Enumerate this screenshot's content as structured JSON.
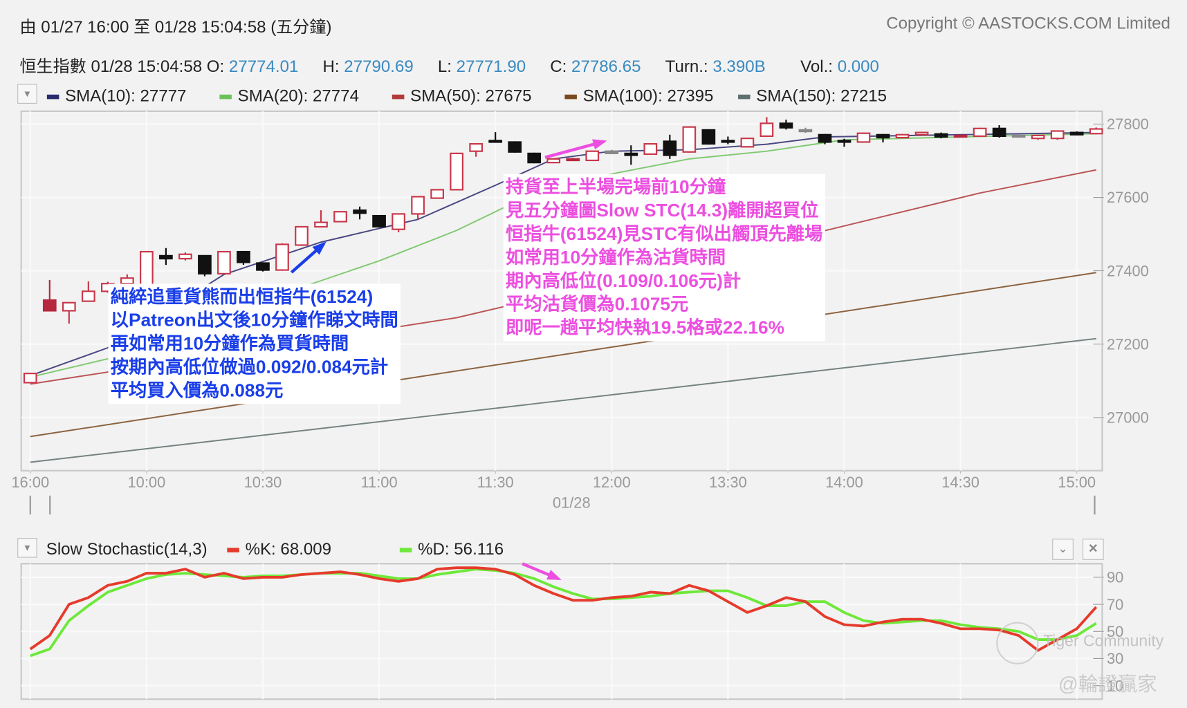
{
  "header": {
    "range_text": "由  01/27 16:00 至  01/28 15:04:58 (五分鐘)",
    "copyright": "Copyright © AASTOCKS.COM Limited"
  },
  "quote": {
    "name_time": "恒生指數 01/28 15:04:58 O:",
    "open": "27774.01",
    "high_label": "H:",
    "high": "27790.69",
    "low_label": "L:",
    "low": "27771.90",
    "close_label": "C:",
    "close": "27786.65",
    "turn_label": "Turn.:",
    "turn": "3.390B",
    "vol_label": "Vol.:",
    "vol": "0.000"
  },
  "legend": [
    {
      "label": "SMA(10): 27777",
      "color": "#2b2a6e"
    },
    {
      "label": "SMA(20): 27774",
      "color": "#6cc25a"
    },
    {
      "label": "SMA(50): 27675",
      "color": "#b23a3a"
    },
    {
      "label": "SMA(100): 27395",
      "color": "#7a4a1e"
    },
    {
      "label": "SMA(150): 27215",
      "color": "#5e6e6e"
    }
  ],
  "stoch_legend": {
    "title": "Slow Stochastic(14,3)",
    "k_label": "%K: 68.009",
    "k_color": "#e53b2c",
    "d_label": "%D: 56.116",
    "d_color": "#6ee83a"
  },
  "annotations": {
    "buy": [
      "純綷追重貨熊而出恒指牛(61524)",
      "以Patreon出文後10分鐘作睇文時間",
      "再如常用10分鐘作為買貨時間",
      "按期內高低位做過0.092/0.084元計",
      "平均買入價為0.088元"
    ],
    "sell": [
      "持貨至上半場完場前10分鐘",
      "見五分鐘圖Slow STC(14.3)離開超買位",
      "恒指牛(61524)見STC有似出觸頂先離場",
      "如常用10分鐘作為沽貨時間",
      "期內高低位(0.109/0.106元)計",
      "平均沽貨價為0.1075元",
      "即呢一趟平均快執19.5格或22.16%"
    ],
    "buy_color": "#1a3ee8",
    "sell_color": "#ec4fe0"
  },
  "watermark": {
    "logo_text": "Tiger Community",
    "author": "@輪證贏家"
  },
  "chart_data": [
    {
      "type": "candlestick",
      "title": "恒生指數 5-minute",
      "ylim": [
        26855,
        27835
      ],
      "y_ticks": [
        "27800",
        "27600",
        "27400",
        "27200",
        "27000"
      ],
      "y_tick_values": [
        27800,
        27600,
        27400,
        27200,
        27000
      ],
      "x_ticks": [
        {
          "label": "16:00",
          "index": 0
        },
        {
          "label": "10:00",
          "index": 6
        },
        {
          "label": "10:30",
          "index": 12
        },
        {
          "label": "11:00",
          "index": 18
        },
        {
          "label": "11:30",
          "index": 24
        },
        {
          "label": "12:00",
          "index": 30
        },
        {
          "label": "13:30",
          "index": 36
        },
        {
          "label": "14:00",
          "index": 42
        },
        {
          "label": "14:30",
          "index": 48
        },
        {
          "label": "15:00",
          "index": 54
        }
      ],
      "date_label": "01/28",
      "candles": [
        [
          27095,
          27122,
          27093,
          27120,
          "hollow"
        ],
        [
          27320,
          27375,
          27291,
          27291,
          "red"
        ],
        [
          27291,
          27313,
          27256,
          27313,
          "hollow"
        ],
        [
          27317,
          27371,
          27317,
          27344,
          "hollow"
        ],
        [
          27344,
          27370,
          27340,
          27365,
          "hollow"
        ],
        [
          27365,
          27390,
          27360,
          27380,
          "hollow"
        ],
        [
          27344,
          27452,
          27340,
          27452,
          "hollow"
        ],
        [
          27441,
          27462,
          27416,
          27433,
          "black"
        ],
        [
          27433,
          27450,
          27428,
          27445,
          "hollow"
        ],
        [
          27441,
          27441,
          27385,
          27392,
          "black"
        ],
        [
          27392,
          27452,
          27392,
          27452,
          "hollow"
        ],
        [
          27452,
          27452,
          27416,
          27423,
          "black"
        ],
        [
          27421,
          27421,
          27398,
          27402,
          "black"
        ],
        [
          27402,
          27475,
          27400,
          27472,
          "hollow"
        ],
        [
          27470,
          27520,
          27468,
          27520,
          "hollow"
        ],
        [
          27520,
          27565,
          27520,
          27532,
          "hollow"
        ],
        [
          27534,
          27561,
          27534,
          27561,
          "hollow"
        ],
        [
          27565,
          27575,
          27540,
          27557,
          "black"
        ],
        [
          27550,
          27550,
          27518,
          27520,
          "black"
        ],
        [
          27513,
          27555,
          27505,
          27555,
          "hollow"
        ],
        [
          27555,
          27602,
          27540,
          27602,
          "hollow"
        ],
        [
          27598,
          27621,
          27598,
          27621,
          "hollow"
        ],
        [
          27621,
          27722,
          27621,
          27720,
          "hollow"
        ],
        [
          27726,
          27748,
          27711,
          27746,
          "hollow"
        ],
        [
          27755,
          27778,
          27751,
          27751,
          "black"
        ],
        [
          27751,
          27753,
          27722,
          27724,
          "black"
        ],
        [
          27720,
          27722,
          27693,
          27695,
          "black"
        ],
        [
          27695,
          27707,
          27693,
          27705,
          "hollow"
        ],
        [
          27705,
          27708,
          27699,
          27701,
          "red"
        ],
        [
          27701,
          27728,
          27699,
          27726,
          "hollow"
        ],
        [
          27726,
          27730,
          27718,
          27720,
          "gray"
        ],
        [
          27720,
          27742,
          27689,
          27715,
          "black"
        ],
        [
          27718,
          27748,
          27716,
          27746,
          "hollow"
        ],
        [
          27753,
          27771,
          27705,
          27715,
          "black"
        ],
        [
          27724,
          27794,
          27722,
          27792,
          "hollow"
        ],
        [
          27784,
          27786,
          27744,
          27746,
          "black"
        ],
        [
          27755,
          27766,
          27745,
          27751,
          "black"
        ],
        [
          27738,
          27763,
          27736,
          27761,
          "hollow"
        ],
        [
          27767,
          27819,
          27765,
          27802,
          "hollow"
        ],
        [
          27802,
          27812,
          27785,
          27790,
          "black"
        ],
        [
          27784,
          27790,
          27776,
          27780,
          "gray"
        ],
        [
          27771,
          27773,
          27745,
          27751,
          "black"
        ],
        [
          27755,
          27760,
          27738,
          27751,
          "black"
        ],
        [
          27751,
          27777,
          27749,
          27775,
          "hollow"
        ],
        [
          27771,
          27773,
          27750,
          27763,
          "black"
        ],
        [
          27763,
          27773,
          27761,
          27771,
          "hollow"
        ],
        [
          27771,
          27779,
          27769,
          27777,
          "hollow"
        ],
        [
          27773,
          27777,
          27761,
          27765,
          "black"
        ],
        [
          27769,
          27771,
          27765,
          27768,
          "red"
        ],
        [
          27767,
          27790,
          27765,
          27788,
          "hollow"
        ],
        [
          27788,
          27797,
          27763,
          27767,
          "black"
        ],
        [
          27769,
          27771,
          27767,
          27768,
          "gray"
        ],
        [
          27761,
          27771,
          27757,
          27769,
          "hollow"
        ],
        [
          27761,
          27783,
          27757,
          27781,
          "hollow"
        ],
        [
          27777,
          27780,
          27769,
          27771,
          "black"
        ],
        [
          27774.01,
          27790.69,
          27771.9,
          27786.65,
          "hollow"
        ]
      ],
      "candle_fields": [
        "open",
        "high",
        "low",
        "close",
        "style"
      ],
      "series": [
        {
          "name": "SMA(10)",
          "color": "#2b2a6e",
          "points": [
            [
              0,
              27114
            ],
            [
              4,
              27190
            ],
            [
              10,
              27390
            ],
            [
              15,
              27478
            ],
            [
              20,
              27540
            ],
            [
              24,
              27633
            ],
            [
              27,
              27705
            ],
            [
              30,
              27726
            ],
            [
              34,
              27730
            ],
            [
              38,
              27745
            ],
            [
              41,
              27765
            ],
            [
              55,
              27777
            ]
          ]
        },
        {
          "name": "SMA(20)",
          "color": "#6cc25a",
          "points": [
            [
              0,
              27110
            ],
            [
              4,
              27160
            ],
            [
              14,
              27355
            ],
            [
              18,
              27427
            ],
            [
              22,
              27510
            ],
            [
              26,
              27612
            ],
            [
              30,
              27664
            ],
            [
              34,
              27705
            ],
            [
              38,
              27726
            ],
            [
              42,
              27757
            ],
            [
              55,
              27774
            ]
          ]
        },
        {
          "name": "SMA(50)",
          "color": "#b23a3a",
          "points": [
            [
              0,
              27091
            ],
            [
              22,
              27272
            ],
            [
              37,
              27458
            ],
            [
              49,
              27612
            ],
            [
              55,
              27675
            ]
          ]
        },
        {
          "name": "SMA(100)",
          "color": "#7a4a1e",
          "points": [
            [
              0,
              26948
            ],
            [
              55,
              27395
            ]
          ]
        },
        {
          "name": "SMA(150)",
          "color": "#5e6e6e",
          "points": [
            [
              0,
              26878
            ],
            [
              55,
              27215
            ]
          ]
        }
      ]
    },
    {
      "type": "line",
      "title": "Slow Stochastic(14,3)",
      "ylim": [
        0,
        100
      ],
      "y_ticks": [
        "90",
        "70",
        "50",
        "30",
        "10"
      ],
      "y_tick_values": [
        90,
        70,
        50,
        30,
        10
      ],
      "series": [
        {
          "name": "%K",
          "color": "#e53b2c",
          "values": [
            37,
            47,
            70,
            75,
            84,
            87,
            93,
            93,
            96,
            90,
            93,
            89,
            90,
            90,
            92,
            93,
            94,
            92,
            89,
            87,
            89,
            96,
            97,
            97,
            96,
            92,
            84,
            78,
            73,
            73,
            75,
            76,
            79,
            78,
            84,
            80,
            72,
            64,
            69,
            75,
            72,
            61,
            55,
            54,
            57,
            59,
            59,
            56,
            52,
            52,
            51,
            47,
            36,
            44,
            52,
            68
          ]
        },
        {
          "name": "%D",
          "color": "#6ee83a",
          "values": [
            32,
            37,
            58,
            69,
            79,
            84,
            89,
            92,
            93,
            92,
            91,
            90,
            91,
            91,
            92,
            93,
            93,
            93,
            91,
            89,
            89,
            92,
            94,
            96,
            95,
            93,
            89,
            83,
            78,
            74,
            74,
            75,
            76,
            78,
            79,
            80,
            80,
            75,
            69,
            69,
            72,
            72,
            64,
            58,
            56,
            57,
            58,
            58,
            55,
            53,
            52,
            50,
            44,
            44,
            47,
            56
          ]
        }
      ]
    }
  ]
}
